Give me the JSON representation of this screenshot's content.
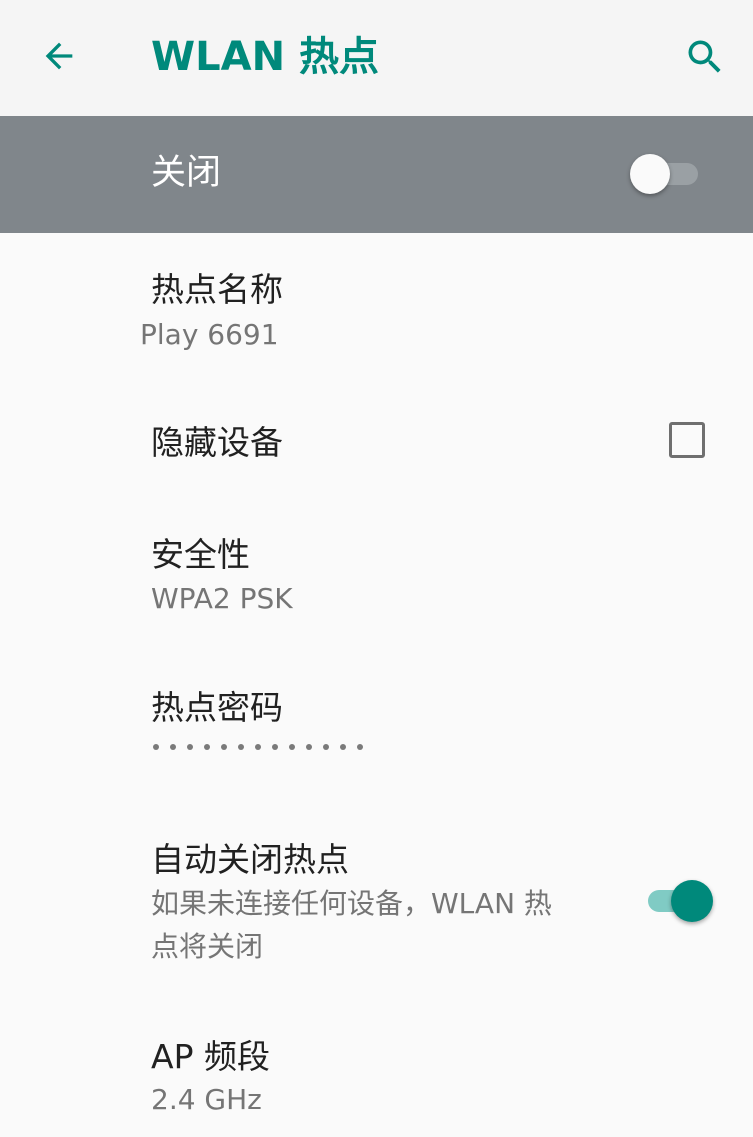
{
  "app_bar": {
    "title": "WLAN 热点",
    "back_icon": "arrow-back-icon",
    "search_icon": "search-icon",
    "accent_color": "#00897b"
  },
  "master_switch": {
    "label": "关闭",
    "state": "off",
    "bar_color": "#80868b"
  },
  "settings": {
    "hotspot_name": {
      "title": "热点名称",
      "summary": "Play 6691"
    },
    "hide_device": {
      "title": "隐藏设备",
      "checked": false
    },
    "security": {
      "title": "安全性",
      "summary": "WPA2 PSK"
    },
    "hotspot_password": {
      "title": "热点密码",
      "masked_length": 13
    },
    "auto_off": {
      "title": "自动关闭热点",
      "summary_line1": "如果未连接任何设备，WLAN 热",
      "summary_line2": "点将关闭",
      "state": "on"
    },
    "ap_band": {
      "title": "AP 频段",
      "summary": "2.4 GHz"
    }
  }
}
